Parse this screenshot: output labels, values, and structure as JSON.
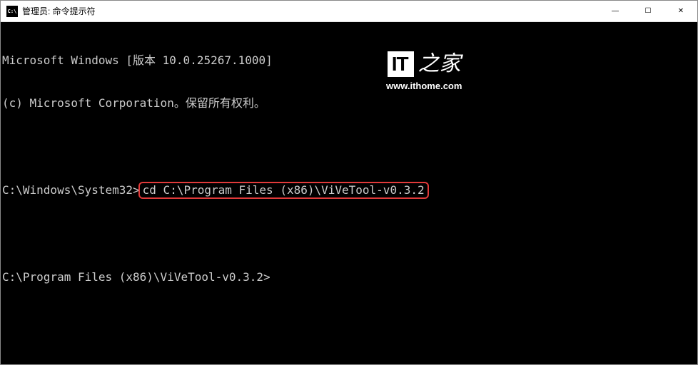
{
  "titlebar": {
    "icon_text": "C:\\",
    "title": "管理员: 命令提示符"
  },
  "window_controls": {
    "minimize": "—",
    "maximize": "☐",
    "close": "✕"
  },
  "terminal": {
    "line1": "Microsoft Windows [版本 10.0.25267.1000]",
    "line2": "(c) Microsoft Corporation。保留所有权利。",
    "prompt1_path": "C:\\Windows\\System32>",
    "prompt1_command": "cd C:\\Program Files (x86)\\ViVeTool-v0.3.2",
    "prompt2_path": "C:\\Program Files (x86)\\ViVeTool-v0.3.2>"
  },
  "watermark": {
    "it": "IT",
    "zhijia": "之家",
    "url": "www.ithome.com"
  }
}
